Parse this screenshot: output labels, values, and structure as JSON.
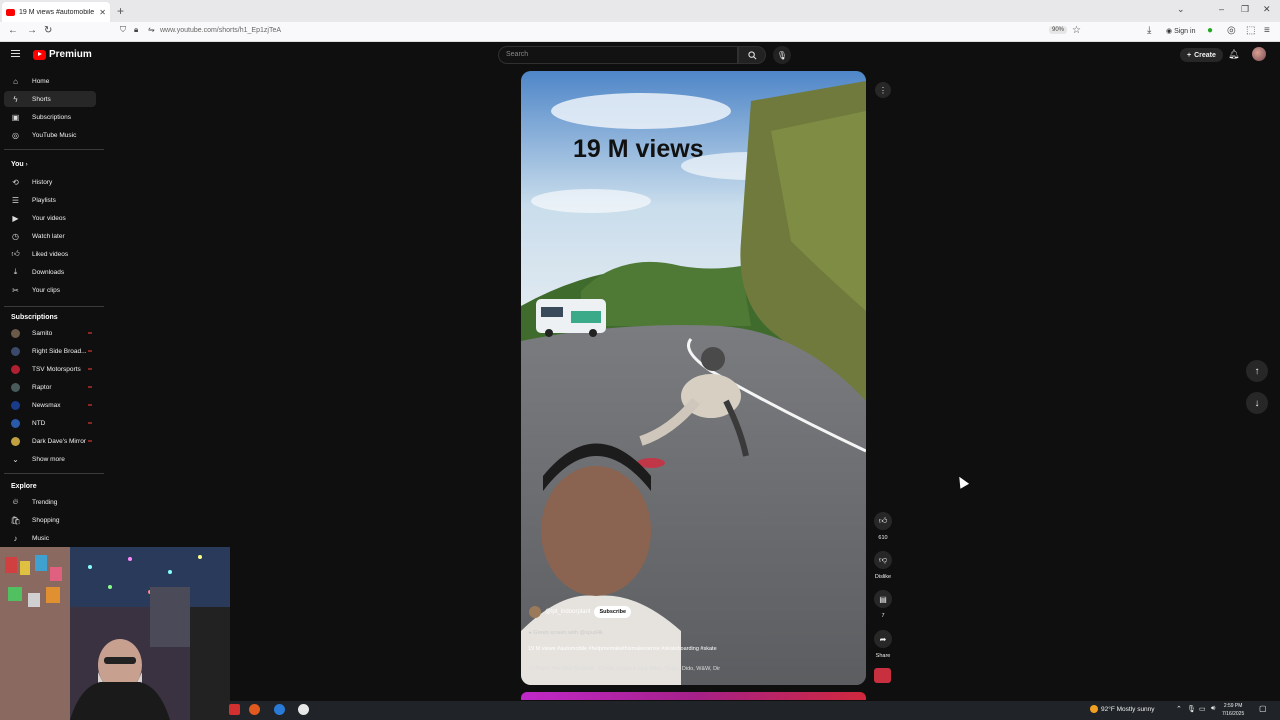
{
  "browser": {
    "tab_title": "19 M views #automobile #",
    "url": "www.youtube.com/shorts/h1_Ep1zjTeA",
    "zoom": "90%",
    "signin": "Sign in"
  },
  "header": {
    "logo_text": "Premium",
    "search_placeholder": "Search",
    "create_label": "Create"
  },
  "sidebar": {
    "main": [
      {
        "label": "Home",
        "icon": "home-icon"
      },
      {
        "label": "Shorts",
        "icon": "shorts-icon"
      },
      {
        "label": "Subscriptions",
        "icon": "subscriptions-icon"
      },
      {
        "label": "YouTube Music",
        "icon": "music-icon"
      }
    ],
    "you_heading": "You",
    "you": [
      {
        "label": "History",
        "icon": "history-icon"
      },
      {
        "label": "Playlists",
        "icon": "playlists-icon"
      },
      {
        "label": "Your videos",
        "icon": "your-videos-icon"
      },
      {
        "label": "Watch later",
        "icon": "watch-later-icon"
      },
      {
        "label": "Liked videos",
        "icon": "like-icon"
      },
      {
        "label": "Downloads",
        "icon": "download-icon"
      },
      {
        "label": "Your clips",
        "icon": "scissors-icon"
      }
    ],
    "subscriptions_heading": "Subscriptions",
    "subscriptions": [
      {
        "label": "Samito",
        "color": "#6a5a4a"
      },
      {
        "label": "Right Side Broad...",
        "color": "#3a4a6a"
      },
      {
        "label": "TSV Motorsports",
        "color": "#b02030"
      },
      {
        "label": "Raptor",
        "color": "#4a5a5a"
      },
      {
        "label": "Newsmax",
        "color": "#1a3a8a"
      },
      {
        "label": "NTD",
        "color": "#2a5aaa"
      },
      {
        "label": "Dark Dave's Mirror",
        "color": "#c0a040"
      }
    ],
    "show_more": "Show more",
    "explore_heading": "Explore",
    "explore": [
      {
        "label": "Trending",
        "icon": "trending-icon"
      },
      {
        "label": "Shopping",
        "icon": "shopping-icon"
      },
      {
        "label": "Music",
        "icon": "music-note-icon"
      }
    ]
  },
  "short": {
    "overlay_text": "19 M views",
    "channel": "@ipt_indoorplant",
    "subscribe": "Subscribe",
    "green_screen": "Green screen with @spud4k",
    "description": "19 M views #automobile #helpmemakethismakesense #skateboarding #skate",
    "music": "Thank You (Not So Bad) · Dimitri Vegas & Like Mike, Tiësto, Dido, W&W, Dir"
  },
  "actions": {
    "likes": "610",
    "dislike": "Dislike",
    "comments": "7",
    "share": "Share"
  },
  "taskbar": {
    "weather": "92°F  Mostly sunny",
    "time": "2:59 PM",
    "date": "7/16/2025"
  }
}
